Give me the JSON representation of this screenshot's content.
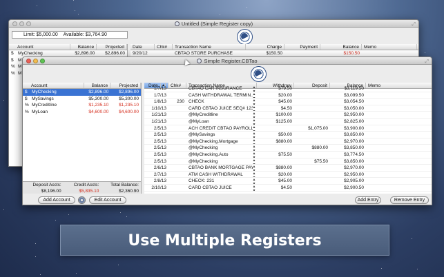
{
  "back_window": {
    "title": "Untitled (Simple Register copy)",
    "limit_text": "Limit: $5,000.00",
    "available_text": "Available: $3,764.90",
    "accounts_header": [
      "Account",
      "Balance",
      "Projected"
    ],
    "accounts": [
      {
        "type": "$",
        "name": "MyChecking",
        "balance": "$2,896.00",
        "projected": "$2,896.00"
      },
      {
        "type": "$",
        "name": "M",
        "balance": "",
        "projected": ""
      },
      {
        "type": "%",
        "name": "M",
        "balance": "",
        "projected": ""
      },
      {
        "type": "%",
        "name": "M",
        "balance": "",
        "projected": ""
      }
    ],
    "register_header": [
      "Date",
      "Chk#",
      "Transaction Name",
      "Charge",
      "Payment",
      "Balance",
      "Memo"
    ],
    "register_rows": [
      {
        "date": "9/20/12",
        "chk": "",
        "name": "CBTAO STORE PURCHASE",
        "charge": "$150.50",
        "payment": "",
        "balance": "$150.50",
        "memo": ""
      }
    ]
  },
  "front_window": {
    "title": "Simple Register.CBTao",
    "accounts_header": [
      "Account",
      "Balance",
      "Projected"
    ],
    "accounts": [
      {
        "type": "$",
        "name": "MyChecking",
        "balance": "$2,896.00",
        "projected": "$2,896.00",
        "selected": true,
        "negative": false
      },
      {
        "type": "$",
        "name": "MySavings",
        "balance": "$5,300.00",
        "projected": "$5,300.00",
        "selected": false,
        "negative": false
      },
      {
        "type": "%",
        "name": "MyCreditline",
        "balance": "$1,235.10",
        "projected": "$1,235.10",
        "selected": false,
        "negative": true
      },
      {
        "type": "%",
        "name": "MyLoan",
        "balance": "$4,600.00",
        "projected": "$4,600.00",
        "selected": false,
        "negative": true
      }
    ],
    "totals_labels": [
      "Deposit Accts:",
      "Credit Accts:",
      "Total Balance:"
    ],
    "totals_values": [
      "$8,196.00",
      "$5,835.10",
      "$2,360.90"
    ],
    "add_account_label": "Add Account",
    "edit_account_label": "Edit Account",
    "register_header": [
      "Date",
      "Chk#",
      "Transaction Name",
      "Withdraw",
      "Deposit",
      "Balance",
      "Memo"
    ],
    "register_rows": [
      {
        "date": "1/7/13",
        "chk": "",
        "name": "CBTAO CAR INSURANCE",
        "withdraw": "$79.50",
        "deposit": "",
        "balance": "$3,119.50"
      },
      {
        "date": "1/7/13",
        "chk": "",
        "name": "CASH WITHDRAWAL TERMIN...",
        "withdraw": "$20.00",
        "deposit": "",
        "balance": "$3,099.50"
      },
      {
        "date": "1/8/13",
        "chk": "230",
        "name": "CHECK",
        "withdraw": "$45.00",
        "deposit": "",
        "balance": "$3,054.50"
      },
      {
        "date": "1/10/13",
        "chk": "",
        "name": "CARD CBTAO JUICE SEQ# 12345",
        "withdraw": "$4.50",
        "deposit": "",
        "balance": "$3,050.00"
      },
      {
        "date": "1/21/13",
        "chk": "",
        "name": "@MyCreditline",
        "withdraw": "$100.00",
        "deposit": "",
        "balance": "$2,950.00"
      },
      {
        "date": "1/21/13",
        "chk": "",
        "name": "@MyLoan",
        "withdraw": "$125.00",
        "deposit": "",
        "balance": "$2,825.00"
      },
      {
        "date": "2/5/13",
        "chk": "",
        "name": "ACH CREDIT CBTAO PAYROLL",
        "withdraw": "",
        "deposit": "$1,075.00",
        "balance": "$3,900.00"
      },
      {
        "date": "2/5/13",
        "chk": "",
        "name": "@MySavings",
        "withdraw": "$50.00",
        "deposit": "",
        "balance": "$3,850.00"
      },
      {
        "date": "2/5/13",
        "chk": "",
        "name": "@MyChecking.Mortgage",
        "withdraw": "$880.00",
        "deposit": "",
        "balance": "$2,970.00"
      },
      {
        "date": "2/5/13",
        "chk": "",
        "name": "@MyChecking",
        "withdraw": "",
        "deposit": "$880.00",
        "balance": "$3,850.00"
      },
      {
        "date": "2/5/13",
        "chk": "",
        "name": "@MyChecking.Auto",
        "withdraw": "$75.50",
        "deposit": "",
        "balance": "$3,774.50"
      },
      {
        "date": "2/5/13",
        "chk": "",
        "name": "@MyChecking",
        "withdraw": "",
        "deposit": "$75.50",
        "balance": "$3,850.00"
      },
      {
        "date": "2/6/13",
        "chk": "",
        "name": "CBTAO BANK MORTGAGE PAY...",
        "withdraw": "$880.00",
        "deposit": "",
        "balance": "$2,970.00"
      },
      {
        "date": "2/7/13",
        "chk": "",
        "name": "ATM CASH WITHDRAWAL",
        "withdraw": "$20.00",
        "deposit": "",
        "balance": "$2,950.00"
      },
      {
        "date": "2/8/13",
        "chk": "",
        "name": "CHECK: 231",
        "withdraw": "$45.00",
        "deposit": "",
        "balance": "$2,905.00"
      },
      {
        "date": "2/10/13",
        "chk": "",
        "name": "CARD CBTAO JUICE",
        "withdraw": "$4.50",
        "deposit": "",
        "balance": "$2,900.50"
      }
    ],
    "add_entry_label": "Add Entry",
    "remove_entry_label": "Remove Entry"
  },
  "banner_text": "Use Multiple Registers"
}
